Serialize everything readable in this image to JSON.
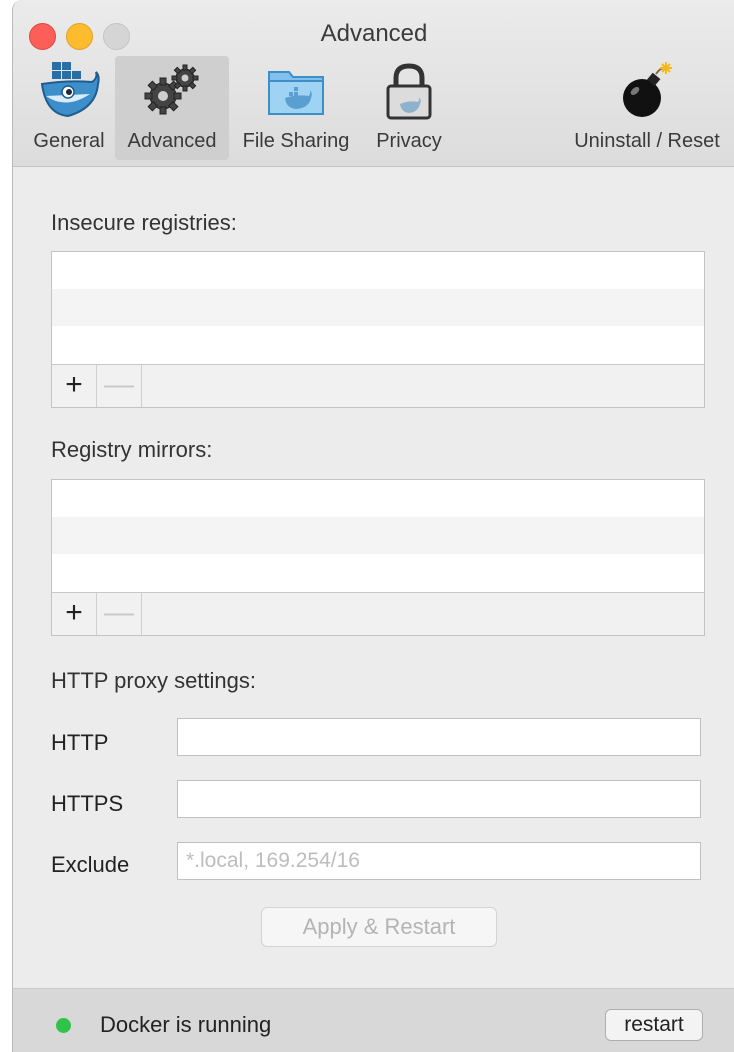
{
  "window": {
    "title": "Advanced"
  },
  "toolbar": {
    "tabs": [
      {
        "label": "General",
        "icon": "docker-whale-icon"
      },
      {
        "label": "Advanced",
        "icon": "gears-icon",
        "selected": true
      },
      {
        "label": "File Sharing",
        "icon": "folder-icon"
      },
      {
        "label": "Privacy",
        "icon": "lock-icon"
      },
      {
        "label": "Uninstall / Reset",
        "icon": "bomb-icon"
      }
    ]
  },
  "insecure_registries": {
    "label": "Insecure registries:",
    "add": "+",
    "remove": "—"
  },
  "registry_mirrors": {
    "label": "Registry mirrors:",
    "add": "+",
    "remove": "—"
  },
  "proxy": {
    "label": "HTTP proxy settings:",
    "http_label": "HTTP",
    "http_value": "",
    "https_label": "HTTPS",
    "https_value": "",
    "exclude_label": "Exclude",
    "exclude_value": "",
    "exclude_placeholder": "*.local, 169.254/16"
  },
  "apply_button": "Apply & Restart",
  "status": {
    "text": "Docker is running",
    "color": "#2fc34a",
    "restart_label": "restart"
  },
  "colors": {
    "close": "#fc5f57",
    "minimize": "#fdbc2e",
    "zoom_disabled": "#d5d5d5"
  }
}
